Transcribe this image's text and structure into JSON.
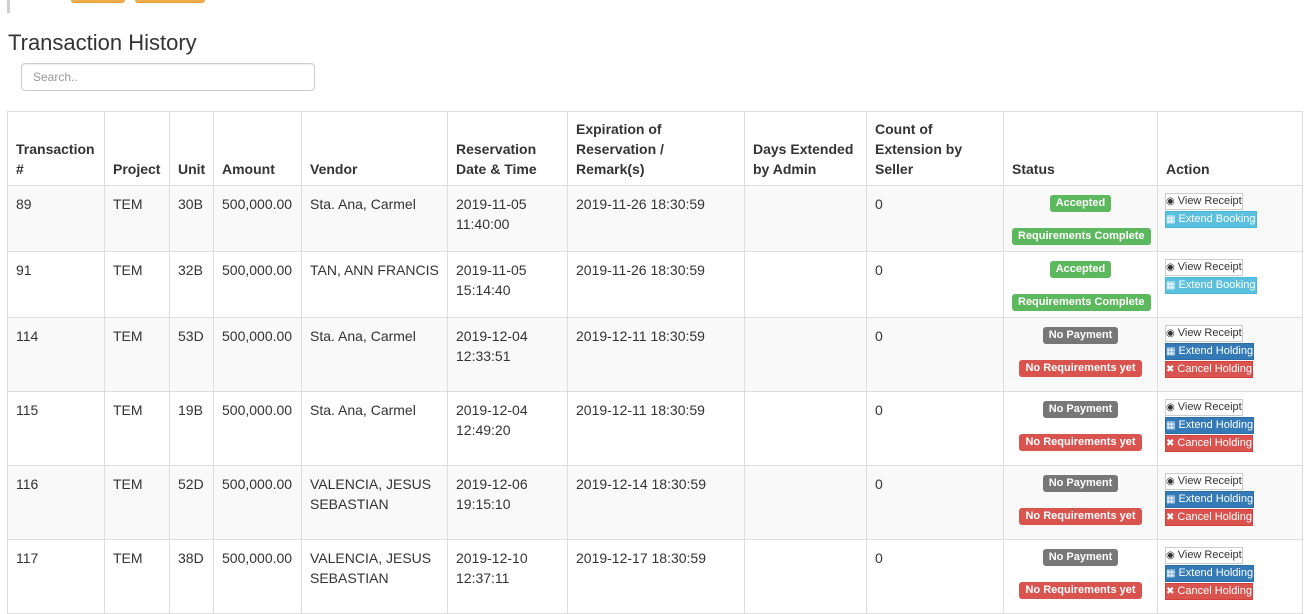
{
  "page": {
    "title": "Transaction History",
    "search_placeholder": "Search.."
  },
  "table": {
    "headers": {
      "transaction": "Transaction #",
      "project": "Project",
      "unit": "Unit",
      "amount": "Amount",
      "vendor": "Vendor",
      "reservation": "Reservation Date & Time",
      "expiration": "Expiration of Reservation / Remark(s)",
      "days_extended": "Days Extended by Admin",
      "count_extension": "Count of Extension by Seller",
      "status": "Status",
      "action": "Action"
    },
    "rows": [
      {
        "transaction": "89",
        "project": "TEM",
        "unit": "30B",
        "amount": "500,000.00",
        "vendor": "Sta. Ana, Carmel",
        "reservation_date": "2019-11-05",
        "reservation_time": "11:40:00",
        "expiration": "2019-11-26 18:30:59",
        "days_extended": "",
        "count_extension": "0",
        "status_primary": "Accepted",
        "status_secondary": "Requirements Complete",
        "btn_receipt": "View Receipt",
        "btn_extend": "Extend Booking"
      },
      {
        "transaction": "91",
        "project": "TEM",
        "unit": "32B",
        "amount": "500,000.00",
        "vendor": "TAN, ANN FRANCIS",
        "reservation_date": "2019-11-05",
        "reservation_time": "15:14:40",
        "expiration": "2019-11-26 18:30:59",
        "days_extended": "",
        "count_extension": "0",
        "status_primary": "Accepted",
        "status_secondary": "Requirements Complete",
        "btn_receipt": "View Receipt",
        "btn_extend": "Extend Booking"
      },
      {
        "transaction": "114",
        "project": "TEM",
        "unit": "53D",
        "amount": "500,000.00",
        "vendor": "Sta. Ana, Carmel",
        "reservation_date": "2019-12-04",
        "reservation_time": "12:33:51",
        "expiration": "2019-12-11 18:30:59",
        "days_extended": "",
        "count_extension": "0",
        "status_primary": "No Payment",
        "status_secondary": "No Requirements yet",
        "btn_receipt": "View Receipt",
        "btn_extend": "Extend Holding",
        "btn_cancel": "Cancel Holding"
      },
      {
        "transaction": "115",
        "project": "TEM",
        "unit": "19B",
        "amount": "500,000.00",
        "vendor": "Sta. Ana, Carmel",
        "reservation_date": "2019-12-04",
        "reservation_time": "12:49:20",
        "expiration": "2019-12-11 18:30:59",
        "days_extended": "",
        "count_extension": "0",
        "status_primary": "No Payment",
        "status_secondary": "No Requirements yet",
        "btn_receipt": "View Receipt",
        "btn_extend": "Extend Holding",
        "btn_cancel": "Cancel Holding"
      },
      {
        "transaction": "116",
        "project": "TEM",
        "unit": "52D",
        "amount": "500,000.00",
        "vendor": "VALENCIA, JESUS SEBASTIAN",
        "reservation_date": "2019-12-06",
        "reservation_time": "19:15:10",
        "expiration": "2019-12-14 18:30:59",
        "days_extended": "",
        "count_extension": "0",
        "status_primary": "No Payment",
        "status_secondary": "No Requirements yet",
        "btn_receipt": "View Receipt",
        "btn_extend": "Extend Holding",
        "btn_cancel": "Cancel Holding"
      },
      {
        "transaction": "117",
        "project": "TEM",
        "unit": "38D",
        "amount": "500,000.00",
        "vendor": "VALENCIA, JESUS SEBASTIAN",
        "reservation_date": "2019-12-10",
        "reservation_time": "12:37:11",
        "expiration": "2019-12-17 18:30:59",
        "days_extended": "",
        "count_extension": "0",
        "status_primary": "No Payment",
        "status_secondary": "No Requirements yet",
        "btn_receipt": "View Receipt",
        "btn_extend": "Extend Holding",
        "btn_cancel": "Cancel Holding"
      }
    ]
  },
  "icons": {
    "receipt": "eye-icon",
    "extend": "calendar-icon",
    "cancel": "close-icon"
  },
  "colors": {
    "success": "#5cb85c",
    "default": "#777777",
    "danger": "#d9534f",
    "info": "#5bc0de",
    "primary": "#337ab7",
    "warning": "#f0ad4e"
  }
}
